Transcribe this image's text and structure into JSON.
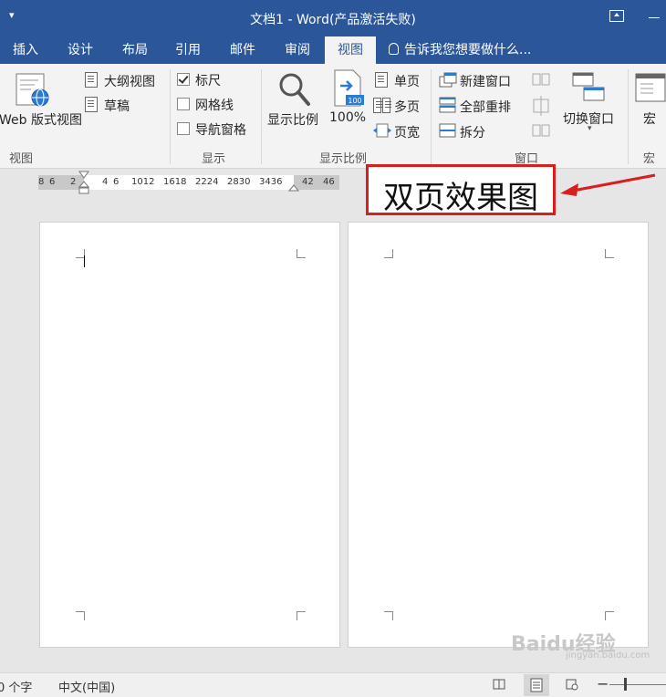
{
  "title_bar": {
    "quick_access": "▾",
    "title": "文档1 - Word(产品激活失败)"
  },
  "tabs": [
    "插入",
    "设计",
    "布局",
    "引用",
    "邮件",
    "审阅",
    "视图"
  ],
  "active_tab": "视图",
  "tell_me": "告诉我您想要做什么...",
  "ribbon": {
    "views": {
      "web_layout": "Web 版式视图",
      "outline": "大纲视图",
      "draft": "草稿",
      "label": "视图"
    },
    "show": {
      "ruler": "标尺",
      "gridlines": "网格线",
      "nav_pane": "导航窗格",
      "label": "显示",
      "ruler_checked": true
    },
    "zoom": {
      "zoom": "显示比例",
      "percent": "100%",
      "percent_badge": "100",
      "one_page": "单页",
      "multi_page": "多页",
      "page_width": "页宽",
      "label": "显示比例"
    },
    "window": {
      "new_window": "新建窗口",
      "arrange_all": "全部重排",
      "split": "拆分",
      "switch": "切换窗口",
      "label": "窗口"
    },
    "macros": {
      "macro": "宏",
      "label": "宏"
    }
  },
  "ruler_ticks": [
    "8",
    "6",
    "2",
    "4",
    "6",
    "1012",
    "1618",
    "2224",
    "2830",
    "3436",
    "42",
    "46"
  ],
  "annotation": {
    "text": "双页效果图",
    "color": "#d81e1e"
  },
  "status_bar": {
    "word_count": "0 个字",
    "language": "中文(中国)",
    "zoom_minus": "−"
  },
  "watermark": {
    "text": "Baidu经验",
    "sub": "jingyan.baidu.com"
  },
  "colors": {
    "accent": "#2b579a",
    "annotation": "#d81e1e"
  }
}
